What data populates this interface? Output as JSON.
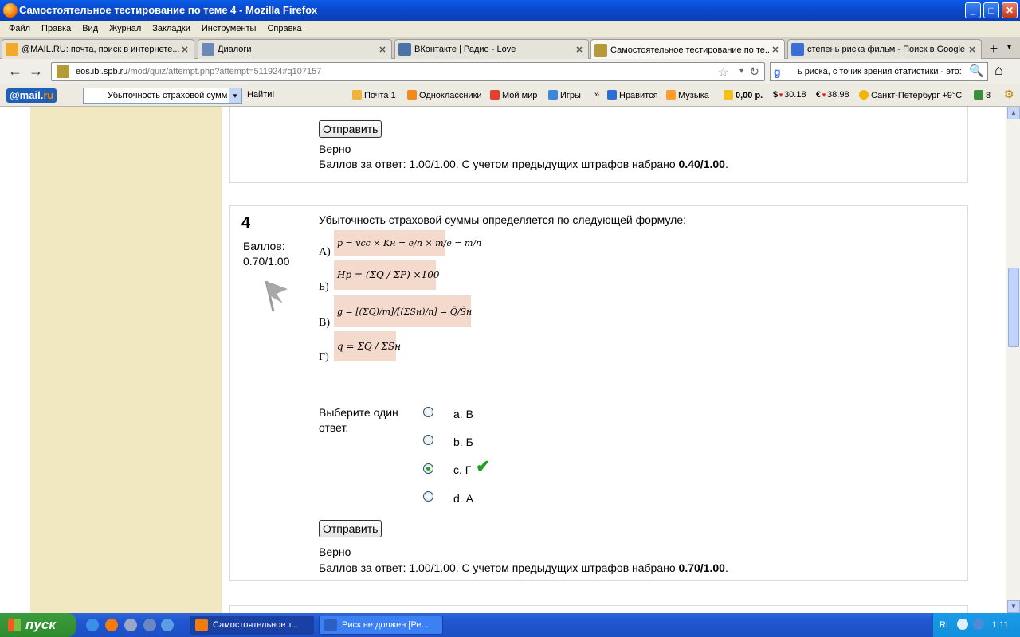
{
  "window": {
    "title": "Самостоятельное тестирование по теме 4 - Mozilla Firefox",
    "buttons": {
      "minimize": "_",
      "maximize": "□",
      "close": "✕"
    }
  },
  "menu": [
    "Файл",
    "Правка",
    "Вид",
    "Журнал",
    "Закладки",
    "Инструменты",
    "Справка"
  ],
  "tabs": [
    {
      "label": "@MAIL.RU: почта, поиск в интернете...",
      "close": "✕",
      "icon_color": "#f1a92a"
    },
    {
      "label": "Диалоги",
      "close": "✕",
      "icon_color": "#6a89b8"
    },
    {
      "label": "ВКонтакте | Радио - Love",
      "close": "✕",
      "icon_color": "#4a74a8"
    },
    {
      "label": "Самостоятельное тестирование по те...",
      "close": "✕",
      "icon_color": "#b59a3a"
    },
    {
      "label": "степень риска фильм - Поиск в Google",
      "close": "✕",
      "icon_color": "#3a6fd8"
    }
  ],
  "tabbar": {
    "new_tab": "+",
    "list": "▾"
  },
  "nav": {
    "back": "←",
    "forward": "→",
    "url_host": "eos.ibi.spb.ru",
    "url_path": "/mod/quiz/attempt.php?attempt=511924#q107157",
    "star": "☆",
    "dropdown": "▾",
    "reload": "↻",
    "search_engine": "g",
    "search_text": "ь риска, с точик зрения статистики - это:",
    "search_icon": "🔍",
    "home": "⌂"
  },
  "mailru": {
    "logo_left": "@mail.",
    "logo_right": "ru",
    "search_value": "Убыточность страховой сумм",
    "find": "Найти!",
    "items": [
      {
        "label": "Почта 1",
        "icon_color": "#f0b23c"
      },
      {
        "label": "Одноклассники",
        "icon_color": "#f08a1c"
      },
      {
        "label": "Мой мир",
        "icon_color": "#e3402e"
      },
      {
        "label": "Игры",
        "icon_color": "#3e86d8"
      },
      {
        "label": "Нравится",
        "icon_color": "#2c6fd0"
      },
      {
        "label": "Музыка",
        "icon_color": "#ff9d2c"
      },
      {
        "label": "0,00 р.",
        "icon_color": "#f2c020"
      },
      {
        "label": "30.18",
        "icon_color": "#2f9a2f"
      },
      {
        "label": "38.98",
        "icon_color": "#2f9a2f"
      },
      {
        "label": "Санкт-Петербург +9°C",
        "icon_color": "#f2b400"
      },
      {
        "label": "8",
        "icon_color": "#3b8f3b"
      }
    ],
    "more": "»",
    "currency_usd": "$",
    "currency_eur": "€"
  },
  "prev_question": {
    "submit": "Отправить",
    "state": "Верно",
    "grade_text": "Баллов за ответ: 1.00/1.00. С учетом предыдущих штрафов набрано ",
    "grade_total": "0.40/1.00",
    "grade_end": "."
  },
  "question": {
    "number": "4",
    "marks_label": "Баллов:",
    "marks_value": "0.70/1.00",
    "text": "Убыточность страховой суммы определяется по следующей формуле:",
    "formulas": [
      {
        "letter": "А)",
        "expr": "p = vcc × Kн = e/n × m/e = m/n"
      },
      {
        "letter": "Б)",
        "expr": "Hр = (ΣQ / ΣP) ×100"
      },
      {
        "letter": "В)",
        "expr": "g = [(ΣQ)/m]/[(ΣSн)/n] = Q̄/S̄н"
      },
      {
        "letter": "Г)",
        "expr": "q = ΣQ / ΣSн"
      }
    ],
    "prompt": "Выберите один ответ.",
    "options": [
      {
        "label": "a. В",
        "selected": false
      },
      {
        "label": "b. Б",
        "selected": false
      },
      {
        "label": "c. Г",
        "selected": true
      },
      {
        "label": "d. А",
        "selected": false
      }
    ],
    "check_mark": "✔",
    "submit": "Отправить",
    "state": "Верно",
    "grade_text": "Баллов за ответ: 1.00/1.00. С учетом предыдущих штрафов набрано ",
    "grade_total": "0.70/1.00",
    "grade_end": "."
  },
  "scrollbar": {
    "up": "▲",
    "down": "▼"
  },
  "taskbar": {
    "start": "пуск",
    "buttons": [
      {
        "label": "Самостоятельное т...",
        "icon_color": "#f47a0c"
      },
      {
        "label": "Риск не должен [Ре...",
        "icon_color": "#2b5fc1"
      }
    ],
    "lang": "RL",
    "clock": "1:11"
  }
}
